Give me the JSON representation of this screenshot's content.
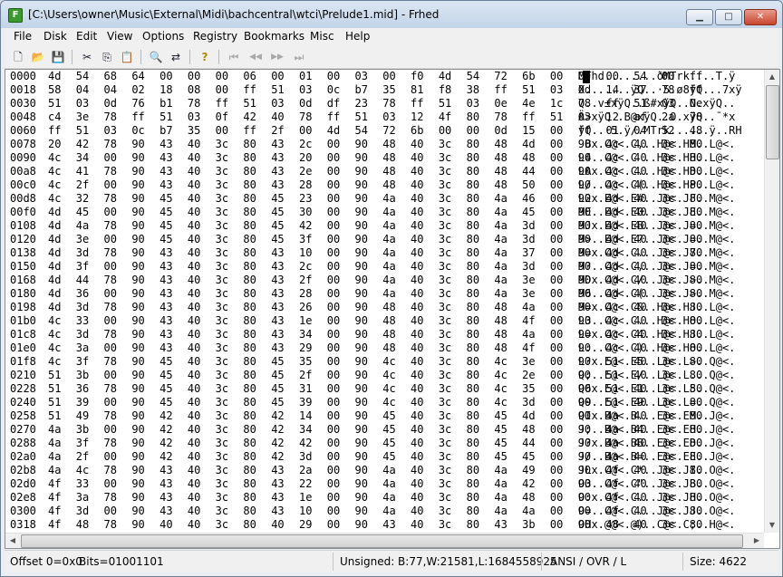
{
  "window": {
    "title": "[C:\\Users\\owner\\Music\\External\\Midi\\bachcentral\\wtci\\Prelude1.mid] - Frhed",
    "app_icon": "F",
    "min_glyph": "▁",
    "max_glyph": "□",
    "close_glyph": "✕"
  },
  "menu": {
    "file": "File",
    "disk": "Disk",
    "edit": "Edit",
    "view": "View",
    "options": "Options",
    "registry": "Registry",
    "bookmarks": "Bookmarks",
    "misc": "Misc",
    "help": "Help"
  },
  "toolbar_glyphs": {
    "new": "🗋",
    "open": "📂",
    "save": "💾",
    "cut": "✂",
    "copy": "⎘",
    "paste": "📋",
    "find": "🔍",
    "replace": "⇄",
    "help": "?",
    "first": "⏮",
    "prev": "◀◀",
    "next": "▶▶",
    "last": "⏭"
  },
  "hex_lines": [
    {
      "offset": "0000",
      "hex": "4d 54 68 64 00 00 00 06 00 01 00 03 00 f0 4d 54 72 6b 00 00 00 54 00 ff",
      "ascii": "MThd........ðMTrk....T.ÿ"
    },
    {
      "offset": "0018",
      "hex": "58 04 04 02 18 08 00 ff 51 03 0c b7 35 81 f8 38 ff 51 03 0d 14 37 78 ff",
      "ascii": "X.......ÿQ..·5.ø8ÿQ...7xÿ"
    },
    {
      "offset": "0030",
      "hex": "51 03 0d 76 b1 78 ff 51 03 0d df 23 78 ff 51 03 0e 4e 1c 78 ff 51 03 0e",
      "ascii": "Q..v±xÿQ..ß#xÿQ..N.xÿQ.."
    },
    {
      "offset": "0048",
      "hex": "c4 3e 78 ff 51 03 0f 42 40 78 ff 51 03 12 4f 80 78 ff 51 03 12 af 2a 78",
      "ascii": "Ä>xÿQ..B@xÿQ..O.xÿQ..¯*x"
    },
    {
      "offset": "0060",
      "hex": "ff 51 03 0c b7 35 00 ff 2f 00 4d 54 72 6b 00 00 0d 15 00 ff 01 04 52 48",
      "ascii": "ÿQ..·5.ÿ/.MTrk......ÿ..RH"
    },
    {
      "offset": "0078",
      "hex": "20 42 78 90 43 40 3c 80 43 2c 00 90 48 40 3c 80 48 4d 00 90 4c 40 3c 80",
      "ascii": " Bx.C@<.C,..H@<.HM..L@<."
    },
    {
      "offset": "0090",
      "hex": "4c 34 00 90 43 40 3c 80 43 20 00 90 48 40 3c 80 48 48 00 90 4c 40 3c 80",
      "ascii": "L4..C@<.C ..H@<.HH..L@<."
    },
    {
      "offset": "00a8",
      "hex": "4c 41 78 90 43 40 3c 80 43 2e 00 90 48 40 3c 80 48 44 00 90 4c 40 3c 80",
      "ascii": "LAx.C@<.C...H@<.HD..L@<."
    },
    {
      "offset": "00c0",
      "hex": "4c 2f 00 90 43 40 3c 80 43 28 00 90 48 40 3c 80 48 50 00 90 4c 40 3c 80",
      "ascii": "L/..C@<.C(..H@<.HP..L@<."
    },
    {
      "offset": "00d8",
      "hex": "4c 32 78 90 45 40 3c 80 45 23 00 90 4a 40 3c 80 4a 46 00 90 4d 40 3c 80",
      "ascii": "L2x.E@<.E#..J@<.JF..M@<."
    },
    {
      "offset": "00f0",
      "hex": "4d 45 00 90 45 40 3c 80 45 30 00 90 4a 40 3c 80 4a 45 00 90 4d 40 3c 80",
      "ascii": "ME..E@<.E0..J@<.JE..M@<."
    },
    {
      "offset": "0108",
      "hex": "4d 4a 78 90 45 40 3c 80 45 42 00 90 4a 40 3c 80 4a 3d 00 90 4d 40 3c 80",
      "ascii": "MJx.E@<.EB..J@<.J=..M@<."
    },
    {
      "offset": "0120",
      "hex": "4d 3e 00 90 45 40 3c 80 45 3f 00 90 4a 40 3c 80 4a 3d 00 90 4d 40 3c 80",
      "ascii": "M>..E@<.E?..J@<.J=..M@<."
    },
    {
      "offset": "0138",
      "hex": "4d 3d 78 90 43 40 3c 80 43 10 00 90 4a 40 3c 80 4a 37 00 90 4d 40 3c 80",
      "ascii": "M=x.C@<.C...J@<.J7..M@<."
    },
    {
      "offset": "0150",
      "hex": "4d 3f 00 90 43 40 3c 80 43 2c 00 90 4a 40 3c 80 4a 3d 00 90 4d 40 3c 80",
      "ascii": "M?..C@<.C,..J@<.J=..M@<."
    },
    {
      "offset": "0168",
      "hex": "4d 44 78 90 43 40 3c 80 43 2f 00 90 4a 40 3c 80 4a 3e 00 90 4d 40 3c 80",
      "ascii": "MDx.C@<.C/..J@<.J>..M@<."
    },
    {
      "offset": "0180",
      "hex": "4d 36 00 90 43 40 3c 80 43 28 00 90 4a 40 3c 80 4a 3e 00 90 4d 40 3c 80",
      "ascii": "M6..C@<.C(..J@<.J>..M@<."
    },
    {
      "offset": "0198",
      "hex": "4d 3d 78 90 43 40 3c 80 43 26 00 90 48 40 3c 80 48 4a 00 90 4c 40 3c 80",
      "ascii": "M=x.C@<.C&..H@<.HJ..L@<."
    },
    {
      "offset": "01b0",
      "hex": "4c 33 00 90 43 40 3c 80 43 1e 00 90 48 40 3c 80 48 4f 00 90 4c 40 3c 80",
      "ascii": "L3..C@<.C...H@<.HO..L@<."
    },
    {
      "offset": "01c8",
      "hex": "4c 3d 78 90 43 40 3c 80 43 34 00 90 48 40 3c 80 48 4a 00 90 4c 40 3c 80",
      "ascii": "L=x.C@<.C4..H@<.HJ..L@<."
    },
    {
      "offset": "01e0",
      "hex": "4c 3a 00 90 43 40 3c 80 43 29 00 90 48 40 3c 80 48 4f 00 90 4c 40 3c 80",
      "ascii": "L:..C@<.C)..H@<.HO..L@<."
    },
    {
      "offset": "01f8",
      "hex": "4c 3f 78 90 45 40 3c 80 45 35 00 90 4c 40 3c 80 4c 3e 00 90 51 40 3c 80",
      "ascii": "L?x.E@<.E5..L@<.L>..Q@<."
    },
    {
      "offset": "0210",
      "hex": "51 3b 00 90 45 40 3c 80 45 2f 00 90 4c 40 3c 80 4c 2e 00 90 51 40 3c 80",
      "ascii": "Q;..E@<.E/..L@<.L...Q@<."
    },
    {
      "offset": "0228",
      "hex": "51 36 78 90 45 40 3c 80 45 31 00 90 4c 40 3c 80 4c 35 00 90 51 40 3c 80",
      "ascii": "Q6x.E@<.E1..L@<.L5..Q@<."
    },
    {
      "offset": "0240",
      "hex": "51 39 00 90 45 40 3c 80 45 39 00 90 4c 40 3c 80 4c 3d 00 90 51 40 3c 80",
      "ascii": "Q9..E@<.E9..L@<.L=..Q@<."
    },
    {
      "offset": "0258",
      "hex": "51 49 78 90 42 40 3c 80 42 14 00 90 45 40 3c 80 45 4d 00 90 4a 40 3c 80",
      "ascii": "QIx.B@<.B...E@<.EM..J@<."
    },
    {
      "offset": "0270",
      "hex": "4a 3b 00 90 42 40 3c 80 42 34 00 90 45 40 3c 80 45 48 00 90 4a 40 3c 80",
      "ascii": "J;..B@<.B4..E@<.EH..J@<."
    },
    {
      "offset": "0288",
      "hex": "4a 3f 78 90 42 40 3c 80 42 42 00 90 45 40 3c 80 45 44 00 90 4a 40 3c 80",
      "ascii": "J?x.B@<.BB..E@<.ED..J@<."
    },
    {
      "offset": "02a0",
      "hex": "4a 2f 00 90 42 40 3c 80 42 3d 00 90 45 40 3c 80 45 45 00 90 4a 40 3c 80",
      "ascii": "J/..B@<.B=..E@<.EE..J@<."
    },
    {
      "offset": "02b8",
      "hex": "4a 4c 78 90 43 40 3c 80 43 2a 00 90 4a 40 3c 80 4a 49 00 90 4f 40 3c 80",
      "ascii": "JLx.C@<.C*..J@<.JI..O@<."
    },
    {
      "offset": "02d0",
      "hex": "4f 33 00 90 43 40 3c 80 43 22 00 90 4a 40 3c 80 4a 42 00 90 4f 40 3c 80",
      "ascii": "O3..C@<.C\"..J@<.JB..O@<."
    },
    {
      "offset": "02e8",
      "hex": "4f 3a 78 90 43 40 3c 80 43 1e 00 90 4a 40 3c 80 4a 48 00 90 4f 40 3c 80",
      "ascii": "O:x.C@<.C...J@<.JH..O@<."
    },
    {
      "offset": "0300",
      "hex": "4f 3d 00 90 43 40 3c 80 43 10 00 90 4a 40 3c 80 4a 4a 00 90 4f 40 3c 80",
      "ascii": "O=..C@<.C...J@<.JJ..O@<."
    },
    {
      "offset": "0318",
      "hex": "4f 48 78 90 40 40 3c 80 40 29 00 90 43 40 3c 80 43 3b 00 90 48 40 3c 80",
      "ascii": "OHx.@@<.@)..C@<.C;..H@<."
    }
  ],
  "status": {
    "offset": "Offset 0=0x0",
    "bits": "Bits=01001101",
    "unsigned": "Unsigned: B:77,W:21581,L:1684558925",
    "mode": "ANSI / OVR / L",
    "size": "Size: 4622"
  },
  "scroll_glyphs": {
    "up": "▲",
    "down": "▼",
    "left": "◀",
    "right": "▶"
  },
  "colors": {
    "close_button": "#c7452e",
    "app_icon": "#3b9a2e"
  }
}
